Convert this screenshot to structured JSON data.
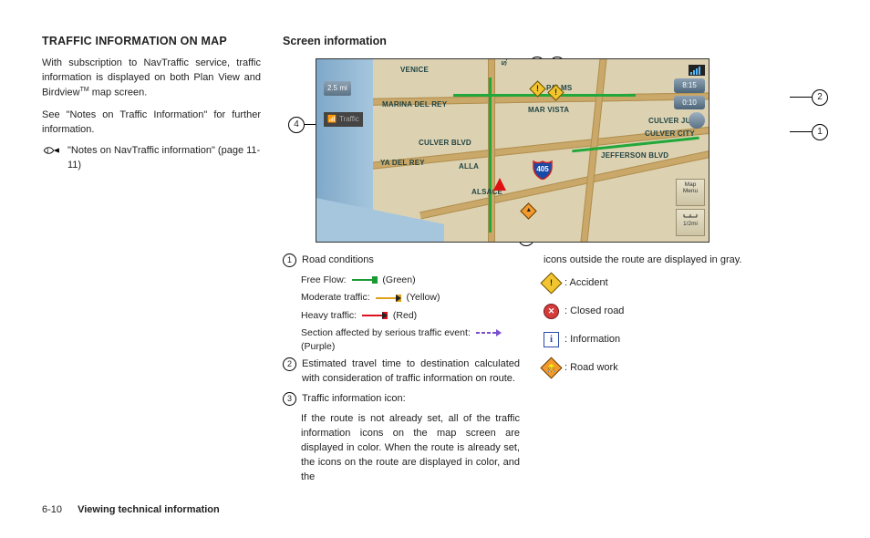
{
  "left": {
    "heading": "TRAFFIC INFORMATION ON MAP",
    "p1a": "With subscription to NavTraffic service, traffic information is displayed on both Plan View and Birdview",
    "p1b": " map screen.",
    "p2": "See \"Notes on Traffic Information\" for further information.",
    "ref_text": "\"Notes on NavTraffic information\" (page 11-11)"
  },
  "right": {
    "heading": "Screen information"
  },
  "map": {
    "scale": "2.5 mi",
    "traffic_label": "Traffic",
    "top_value": "8:15",
    "top_time": "0:10",
    "menu1": "Map Menu",
    "menu2_scale": "1/2mi",
    "labels": {
      "venice": "VENICE",
      "marina": "MARINA DEL REY",
      "yadelrey": "YA DEL REY",
      "palms": "PALMS",
      "marvista": "MAR VISTA",
      "culverjunc": "CULVER JUNC",
      "culvercity": "CULVER CITY",
      "alla": "ALLA",
      "alsace": "ALSACE",
      "sspring": "S. SPRING",
      "culverblvd": "CULVER BLVD",
      "jefferson": "JEFFERSON BLVD"
    },
    "hwy": "405"
  },
  "callouts": {
    "c1": "1",
    "c2": "2",
    "c3": "3",
    "c4": "4"
  },
  "legend": {
    "item1_title": "Road conditions",
    "free_flow": "Free Flow: ",
    "free_flow_color": " (Green)",
    "moderate": "Moderate traffic: ",
    "moderate_color": " (Yellow)",
    "heavy": "Heavy traffic: ",
    "heavy_color": " (Red)",
    "serious": "Section affected by serious traffic event: ",
    "serious_color": " (Purple)",
    "item2": "Estimated travel time to destination calculated with consideration of traffic information on route.",
    "item3_title": "Traffic information icon:",
    "item3_body": "If the route is not already set, all of the traffic information icons on the map screen are displayed in color. When the route is already set, the icons on the route are displayed in color, and the",
    "right_cont": "icons outside the route are displayed in gray.",
    "accident": ": Accident",
    "closed": ": Closed road",
    "info": ": Information",
    "roadwork": ": Road work"
  },
  "footer": {
    "page": "6-10",
    "section": "Viewing technical information"
  }
}
